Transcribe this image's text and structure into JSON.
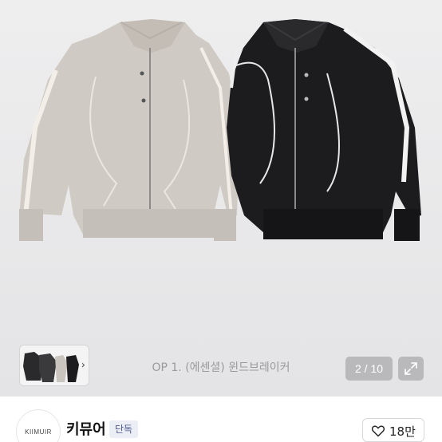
{
  "product": {
    "caption": "OP 1. (에센셜) 윈드브레이커",
    "pager": "2 / 10",
    "thumb_chevron": "›"
  },
  "seller": {
    "logo_text": "KIIMUIR",
    "name": "키뮤어",
    "badge": "단독"
  },
  "likes": {
    "count": "18만"
  },
  "icons": {
    "thumb_next": "chevron-right-icon",
    "expand": "expand-arrows-icon",
    "like": "heart-outline-icon"
  },
  "colors": {
    "background": "#eeeeef",
    "beige_jacket": "#cfcac3",
    "black_jacket": "#1c1c1e",
    "pager_bg": "#b9b9bc",
    "badge_text": "#4e5a8a"
  }
}
